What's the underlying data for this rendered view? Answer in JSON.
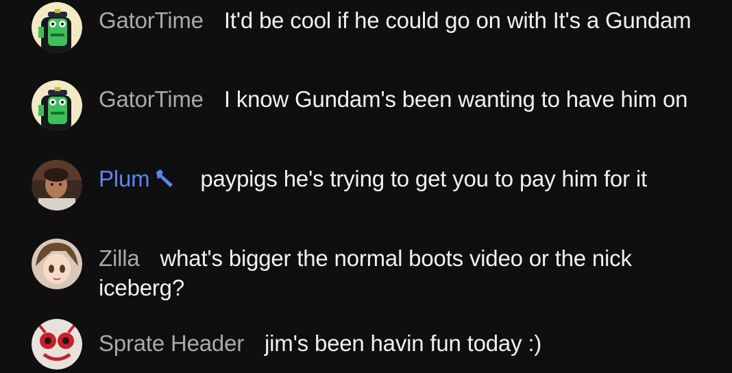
{
  "messages": [
    {
      "author": "GatorTime",
      "text": "It'd be cool if he could go on with It's a Gundam",
      "role": "member",
      "avatar_icon": "gator-avatar"
    },
    {
      "author": "GatorTime",
      "text": "I know Gundam's been wanting to have him on",
      "role": "member",
      "avatar_icon": "gator-avatar"
    },
    {
      "author": "Plum",
      "text": "paypigs he's trying to get you to pay him for it",
      "role": "moderator",
      "badge_icon": "wrench-icon",
      "avatar_icon": "photo-avatar"
    },
    {
      "author": "Zilla",
      "text": "what's bigger the normal boots video or the nick iceberg?",
      "role": "member",
      "avatar_icon": "anime-avatar"
    },
    {
      "author": "Sprate Header",
      "text": "jim's been havin fun today :)",
      "role": "member",
      "avatar_icon": "clown-avatar"
    }
  ],
  "colors": {
    "background": "#0f0f0f",
    "author": "#aaaaaa",
    "moderator": "#5e84f1",
    "text": "#f1f1f1"
  }
}
